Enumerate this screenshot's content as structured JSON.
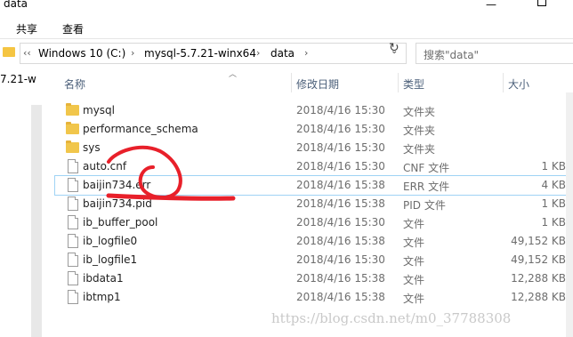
{
  "window": {
    "title": "data"
  },
  "ribbon": {
    "tabs": [
      "共享",
      "查看"
    ]
  },
  "address": {
    "prefix": "‹‹",
    "crumbs": [
      "Windows 10 (C:)",
      "mysql-5.7.21-winx64",
      "data"
    ],
    "separator": "›"
  },
  "search": {
    "placeholder": "搜索\"data\""
  },
  "nav": {
    "partial_text": "7.21-w"
  },
  "columns": {
    "name": "名称",
    "date": "修改日期",
    "type": "类型",
    "size": "大小"
  },
  "files": [
    {
      "icon": "folder-icon",
      "name": "mysql",
      "date": "2018/4/16 15:30",
      "type": "文件夹",
      "size": ""
    },
    {
      "icon": "folder-icon",
      "name": "performance_schema",
      "date": "2018/4/16 15:30",
      "type": "文件夹",
      "size": ""
    },
    {
      "icon": "folder-icon",
      "name": "sys",
      "date": "2018/4/16 15:30",
      "type": "文件夹",
      "size": ""
    },
    {
      "icon": "file-icon",
      "name": "auto.cnf",
      "date": "2018/4/16 15:30",
      "type": "CNF 文件",
      "size": "1 KB"
    },
    {
      "icon": "file-icon",
      "name": "baijin734.err",
      "date": "2018/4/16 15:38",
      "type": "ERR 文件",
      "size": "4 KB"
    },
    {
      "icon": "file-icon",
      "name": "baijin734.pid",
      "date": "2018/4/16 15:38",
      "type": "PID 文件",
      "size": "1 KB"
    },
    {
      "icon": "file-icon",
      "name": "ib_buffer_pool",
      "date": "2018/4/16 15:30",
      "type": "文件",
      "size": "1 KB"
    },
    {
      "icon": "file-icon",
      "name": "ib_logfile0",
      "date": "2018/4/16 15:38",
      "type": "文件",
      "size": "49,152 KB"
    },
    {
      "icon": "file-icon",
      "name": "ib_logfile1",
      "date": "2018/4/16 15:30",
      "type": "文件",
      "size": "49,152 KB"
    },
    {
      "icon": "file-icon",
      "name": "ibdata1",
      "date": "2018/4/16 15:38",
      "type": "文件",
      "size": "12,288 KB"
    },
    {
      "icon": "file-icon",
      "name": "ibtmp1",
      "date": "2018/4/16 15:38",
      "type": "文件",
      "size": "12,288 KB"
    }
  ],
  "watermark": "https://blog.csdn.net/m0_37788308",
  "colors": {
    "folder": "#f1c64b",
    "header_text": "#4c607a",
    "selection": "#9fd3f5",
    "annotation": "#e8202a"
  }
}
